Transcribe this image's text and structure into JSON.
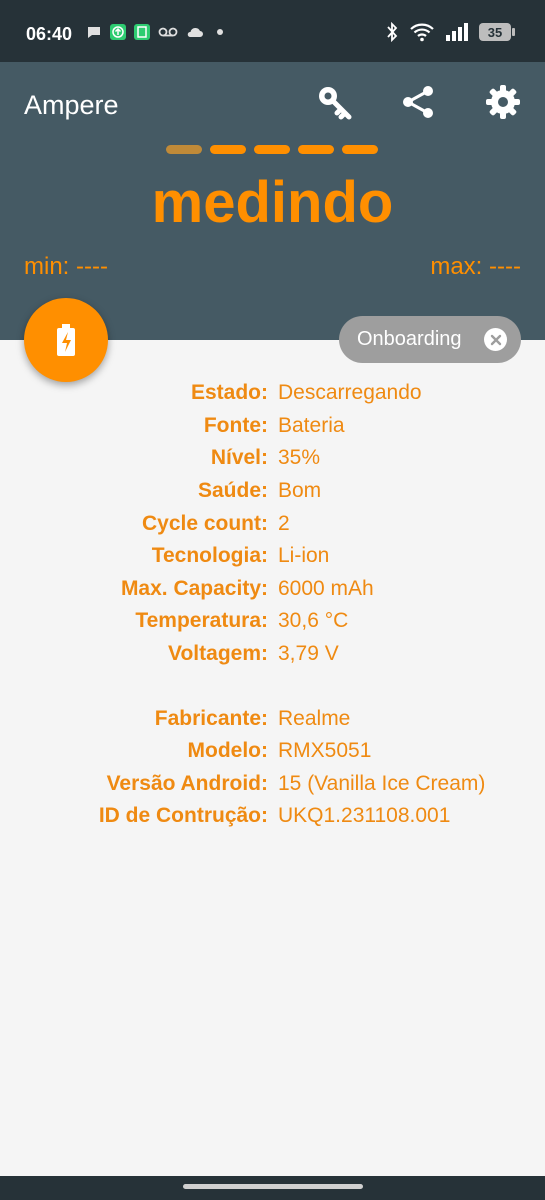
{
  "status_bar": {
    "time": "06:40",
    "battery_level": "35",
    "notification_icons": [
      "chat-icon",
      "upload-app-icon",
      "save-app-icon",
      "voicemail-icon",
      "cloud-icon",
      "dot-icon"
    ],
    "system_icons": [
      "bluetooth-icon",
      "wifi-icon",
      "signal-icon",
      "battery-icon"
    ]
  },
  "header": {
    "title": "Ampere",
    "actions": [
      "key-icon",
      "share-icon",
      "settings-icon"
    ],
    "status": "medindo",
    "min": "min: ----",
    "max": "max: ----",
    "accent_color": "#ff8f00",
    "background_color": "#455a64"
  },
  "fab": {
    "icon": "battery-charging-icon"
  },
  "chip": {
    "label": "Onboarding",
    "close_icon": "close-icon"
  },
  "battery_info": [
    {
      "label": "Estado:",
      "value": "Descarregando"
    },
    {
      "label": "Fonte:",
      "value": "Bateria"
    },
    {
      "label": "Nível:",
      "value": "35%"
    },
    {
      "label": "Saúde:",
      "value": "Bom"
    },
    {
      "label": "Cycle count:",
      "value": "2"
    },
    {
      "label": "Tecnologia:",
      "value": "Li-ion"
    },
    {
      "label": "Max. Capacity:",
      "value": "6000 mAh"
    },
    {
      "label": "Temperatura:",
      "value": "30,6 °C"
    },
    {
      "label": "Voltagem:",
      "value": "3,79 V"
    }
  ],
  "device_info": [
    {
      "label": "Fabricante:",
      "value": "Realme"
    },
    {
      "label": "Modelo:",
      "value": "RMX5051"
    },
    {
      "label": "Versão Android:",
      "value": "15 (Vanilla Ice Cream)"
    },
    {
      "label": "ID de Contrução:",
      "value": "UKQ1.231108.001"
    }
  ]
}
